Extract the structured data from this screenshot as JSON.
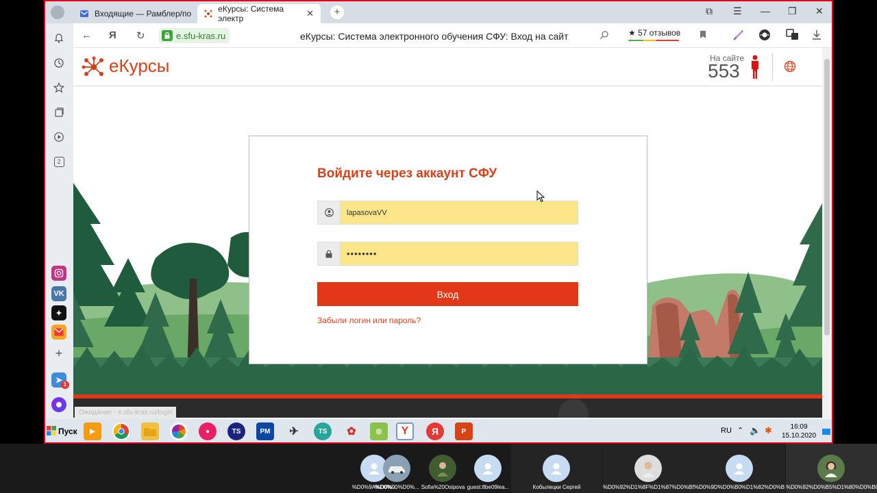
{
  "browser": {
    "tabs": [
      {
        "title": "Входящие — Рамблер/по"
      },
      {
        "title": "eКурсы: Система электр"
      }
    ],
    "address": {
      "domain": "e.sfu-kras.ru",
      "page_title": "еКурсы: Система электронного обучения СФУ: Вход на сайт",
      "reviews": "57 отзывов"
    }
  },
  "site": {
    "logo_text": "еКурсы",
    "online_label": "На сайте",
    "online_count": "553",
    "accent": "#d4421c"
  },
  "login": {
    "title": "Войдите через аккаунт СФУ",
    "username_value": "lapasovaVV",
    "password_value": "••••••••",
    "submit_label": "Вход",
    "forgot_label": "Забыли логин или пароль?"
  },
  "status": {
    "text": "Ожидание - e.sfu-kras.ru/login"
  },
  "sidebar_badge": "1",
  "sidebar_tab_count": "2",
  "taskbar": {
    "start_label": "Пуск",
    "lang": "RU",
    "time": "16:09",
    "date": "15.10.2020"
  },
  "participants": [
    {
      "name": "%D0%9A%D0%..."
    },
    {
      "name": "%D0%90%D0%..."
    },
    {
      "name": "Sofia%20Osipova"
    },
    {
      "name": "guest:8be09lea..."
    },
    {
      "name": "Кобылецки Сергей"
    },
    {
      "name": "%D0%92%D1%8F%D1%87%D0%B5..."
    },
    {
      "name": "%D0%9D%D0%B0%D1%82%D0%B..."
    },
    {
      "name": "%D0%92%D0%B5%D1%80%D0%B0..."
    }
  ]
}
